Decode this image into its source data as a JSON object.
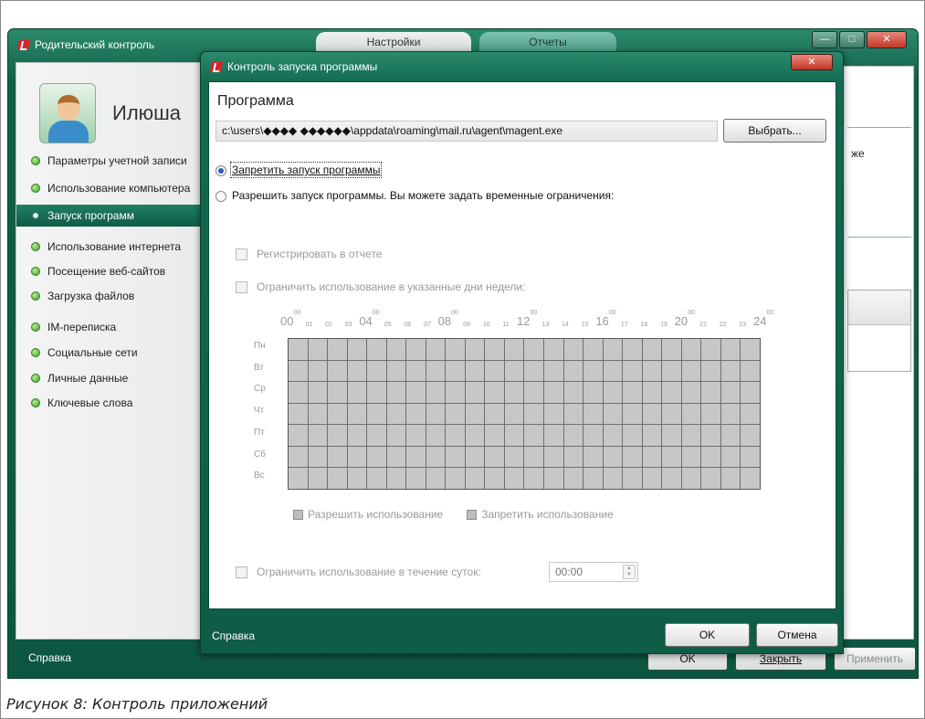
{
  "main_window": {
    "title": "Родительский контроль",
    "tabs": [
      "Настройки",
      "Отчеты"
    ],
    "controls": {
      "minimize": "—",
      "maximize": "□",
      "close": "✕"
    },
    "user_name": "Илюша",
    "nav_items": [
      {
        "label": "Параметры учетной записи",
        "active": false
      },
      {
        "label": "Использование компьютера",
        "active": false
      },
      {
        "label": "Запуск программ",
        "active": true
      },
      {
        "label": "Использование интернета",
        "active": false
      },
      {
        "label": "Посещение веб-сайтов",
        "active": false
      },
      {
        "label": "Загрузка файлов",
        "active": false
      },
      {
        "label": "IM-переписка",
        "active": false
      },
      {
        "label": "Социальные сети",
        "active": false
      },
      {
        "label": "Личные данные",
        "active": false
      },
      {
        "label": "Ключевые слова",
        "active": false
      }
    ],
    "right_fragment": "же",
    "footer": {
      "help": "Справка",
      "ok": "OK",
      "close": "Закрыть",
      "apply": "Применить"
    }
  },
  "dialog": {
    "title": "Контроль запуска программы",
    "close": "✕",
    "section_title": "Программа",
    "program_path": "c:\\users\\◆◆◆◆ ◆◆◆◆◆◆\\appdata\\roaming\\mail.ru\\agent\\magent.exe",
    "choose_button": "Выбрать...",
    "radio_block": "Запретить запуск программы",
    "radio_allow": "Разрешить запуск программы. Вы можете задать временные ограничения:",
    "selected_radio": "block",
    "check_log": "Регистрировать в отчете",
    "check_days": "Ограничить использование в указанные дни недели:",
    "schedule": {
      "hour_labels": [
        "00",
        "01",
        "02",
        "03",
        "04",
        "05",
        "06",
        "07",
        "08",
        "09",
        "10",
        "11",
        "12",
        "13",
        "14",
        "15",
        "16",
        "17",
        "18",
        "19",
        "20",
        "21",
        "22",
        "23",
        "24"
      ],
      "days": [
        "Пн",
        "Вт",
        "Ср",
        "Чт",
        "Пт",
        "Сб",
        "Вс"
      ]
    },
    "legend_allow": "Разрешить использование",
    "legend_deny": "Запретить использование",
    "check_daily": "Ограничить использование в течение суток:",
    "daily_time": "00:00",
    "footer": {
      "help": "Справка",
      "ok": "OK",
      "cancel": "Отмена"
    }
  },
  "caption": "Рисунок 8: Контроль приложений"
}
